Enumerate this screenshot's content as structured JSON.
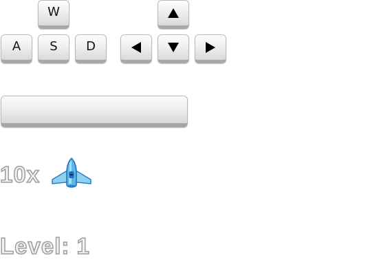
{
  "controls": {
    "wasd": {
      "up": "W",
      "left": "A",
      "down": "S",
      "right": "D"
    },
    "arrows": {
      "up": "arrow-up-icon",
      "left": "arrow-left-icon",
      "down": "arrow-down-icon",
      "right": "arrow-right-icon"
    },
    "fire": "spacebar"
  },
  "hud": {
    "lives_text": "10x",
    "lives_icon": "spaceship-icon",
    "level_text": "Level: 1"
  },
  "colors": {
    "ship_body": "#5bb8e8",
    "ship_cockpit": "#1e6fb8",
    "text_outline": "#9d9d9d"
  }
}
